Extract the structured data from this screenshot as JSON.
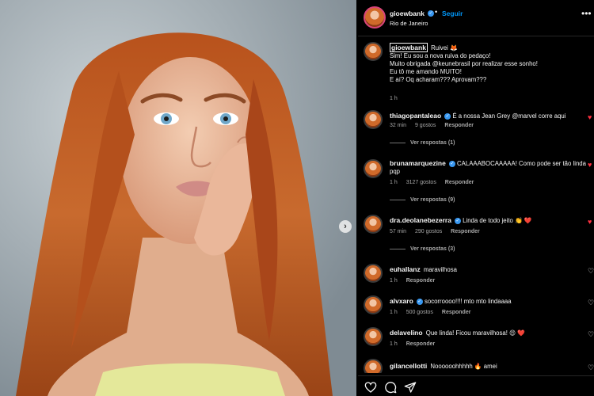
{
  "post": {
    "author": "gioewbank",
    "follow_label": "Seguir",
    "separator": "•",
    "location": "Rio de Janeiro",
    "more_label": "•••"
  },
  "caption": {
    "username": "gioewbank",
    "lines": [
      "Ruivei 🦊",
      "Sim! Eu sou a nova ruiva do pedaço!",
      "Muito obrigada @keunebrasil por realizar esse sonho!",
      "Eu tô me amando MUITO!",
      "E aí? Oq acharam??? Aprovam???"
    ],
    "time": "1 h"
  },
  "comments": [
    {
      "username": "thiagopantaleao",
      "text": "É a nossa Jean Grey @marvel corre aqui",
      "time": "32 min",
      "likes": "9 gostos",
      "reply": "Responder",
      "view_replies": "Ver respostas (1)",
      "heart": "♥",
      "heart_red": true
    },
    {
      "username": "brunamarquezine",
      "text": "CALAAABOCAAAAA! Como pode ser tão linda pqp",
      "time": "1 h",
      "likes": "3127 gostos",
      "reply": "Responder",
      "view_replies": "Ver respostas (9)",
      "heart": "♥",
      "heart_red": true
    },
    {
      "username": "dra.deolanebezerra",
      "text": "Linda de todo jeito 👏 ❤️",
      "time": "57 min",
      "likes": "290 gostos",
      "reply": "Responder",
      "view_replies": "Ver respostas (3)",
      "heart": "♥",
      "heart_red": true
    },
    {
      "username": "euhallanz",
      "text": "maravilhosa",
      "time": "1 h",
      "likes": "",
      "reply": "Responder",
      "view_replies": "",
      "heart": "♡",
      "heart_red": false
    },
    {
      "username": "alvxaro",
      "text": "socorroooo!!!! mto mto lindaaaa",
      "time": "1 h",
      "likes": "500 gostos",
      "reply": "Responder",
      "view_replies": "",
      "heart": "♡",
      "heart_red": false
    },
    {
      "username": "delavelino",
      "text": "Que linda! Ficou maravilhosa! 😍 ❤️",
      "time": "1 h",
      "likes": "",
      "reply": "Responder",
      "view_replies": "",
      "heart": "♡",
      "heart_red": false
    },
    {
      "username": "gilancellotti",
      "text": "Noooooohhhhh 🔥 amei",
      "time": "",
      "likes": "",
      "reply": "",
      "view_replies": "",
      "heart": "♡",
      "heart_red": false
    }
  ],
  "icons": {
    "like": "heart-icon",
    "comment": "comment-icon",
    "share": "share-icon",
    "next": "chevron-right-icon",
    "verified": "verified-badge-icon"
  },
  "colors": {
    "background": "#000000",
    "link": "#0095f6",
    "verified": "#3897f0",
    "like": "#ff3040",
    "muted": "#a8a8a8"
  }
}
